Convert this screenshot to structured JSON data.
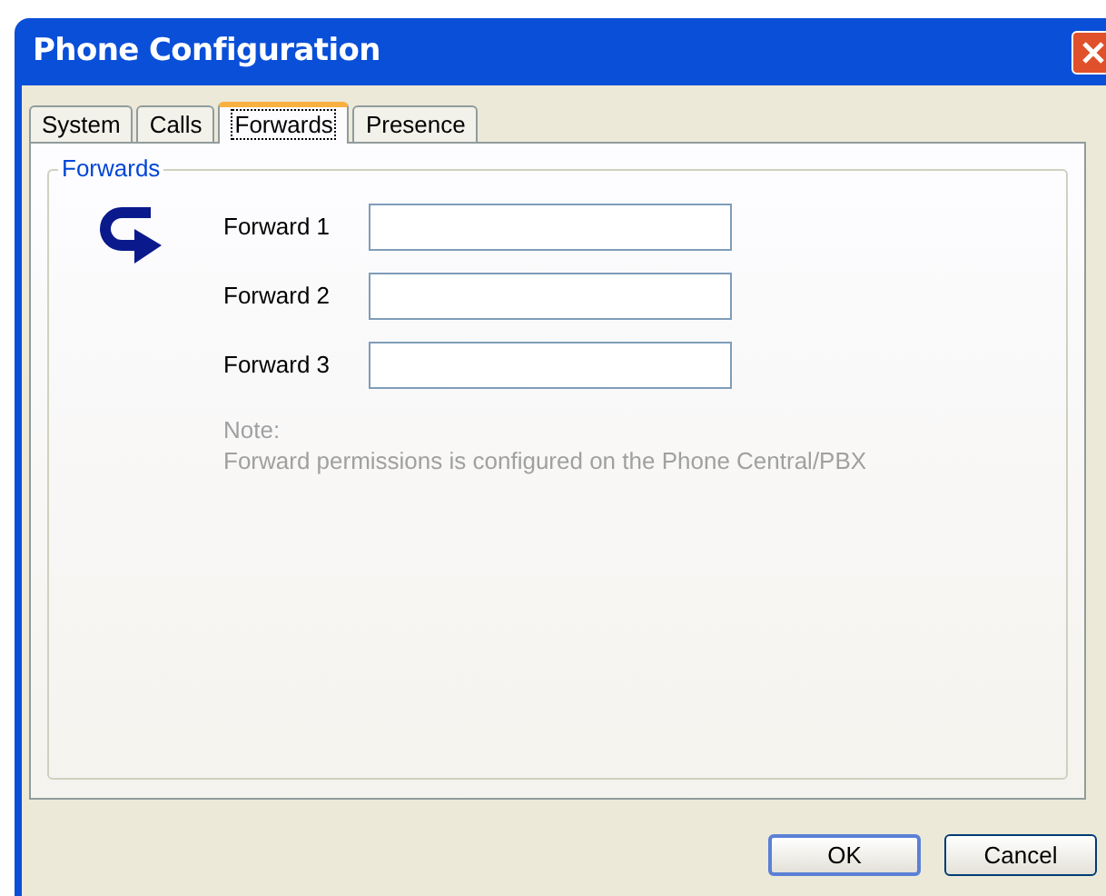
{
  "window": {
    "title": "Phone Configuration"
  },
  "tabs": [
    {
      "label": "System",
      "selected": false
    },
    {
      "label": "Calls",
      "selected": false
    },
    {
      "label": "Forwards",
      "selected": true
    },
    {
      "label": "Presence",
      "selected": false
    }
  ],
  "group": {
    "title": "Forwards"
  },
  "fields": [
    {
      "label": "Forward 1"
    },
    {
      "label": "Forward 2"
    },
    {
      "label": "Forward 3"
    }
  ],
  "note": [
    "Note:",
    "Forward permissions is configured on the Phone Central/PBX"
  ],
  "buttons": [
    {
      "label": "OK",
      "default": true
    },
    {
      "label": "Cancel",
      "default": false
    }
  ]
}
